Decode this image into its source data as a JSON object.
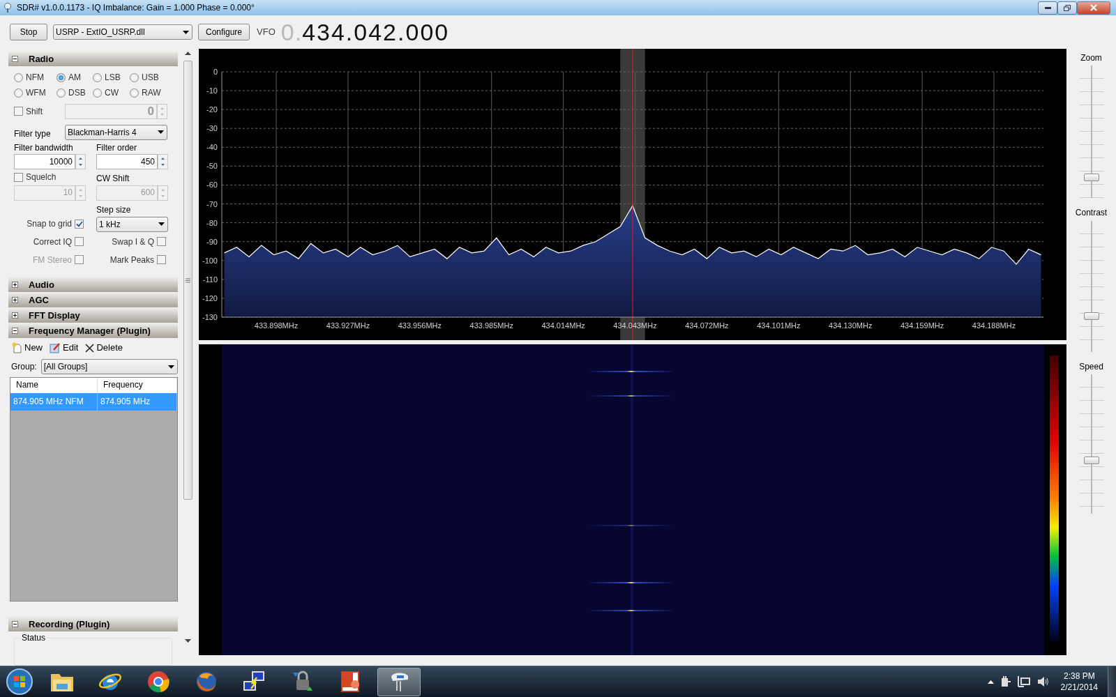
{
  "window": {
    "title": "SDR# v1.0.0.1173 - IQ Imbalance: Gain = 1.000 Phase = 0.000°"
  },
  "toolbar": {
    "stop_button": "Stop",
    "source": "USRP - ExtIO_USRP.dll",
    "configure_button": "Configure",
    "vfo_label": "VFO",
    "vfo_prefix": "0.",
    "vfo_value": "434.042.000"
  },
  "sections": [
    {
      "kind": "radio",
      "title": "Radio",
      "expanded": true,
      "modes": [
        {
          "label": "NFM",
          "selected": false
        },
        {
          "label": "AM",
          "selected": true
        },
        {
          "label": "LSB",
          "selected": false
        },
        {
          "label": "USB",
          "selected": false
        },
        {
          "label": "WFM",
          "selected": false
        },
        {
          "label": "DSB",
          "selected": false
        },
        {
          "label": "CW",
          "selected": false
        },
        {
          "label": "RAW",
          "selected": false
        }
      ],
      "shift": {
        "label": "Shift",
        "checked": false,
        "value": "0",
        "disabled": true
      },
      "filter_type": {
        "label": "Filter type",
        "value": "Blackman-Harris 4"
      },
      "filter_bandwidth": {
        "label": "Filter bandwidth",
        "value": "10000"
      },
      "filter_order": {
        "label": "Filter order",
        "value": "450"
      },
      "squelch": {
        "label": "Squelch",
        "checked": false,
        "value": "10",
        "disabled": true
      },
      "cw_shift": {
        "label": "CW Shift",
        "value": "600",
        "disabled": true
      },
      "snap_to_grid": {
        "label": "Snap to grid",
        "checked": true
      },
      "step_size": {
        "label": "Step size",
        "value": "1 kHz"
      },
      "options": [
        {
          "label": "Correct IQ",
          "checked": false,
          "disabled": false
        },
        {
          "label": "Swap I & Q",
          "checked": false,
          "disabled": false
        },
        {
          "label": "FM Stereo",
          "checked": false,
          "disabled": true
        },
        {
          "label": "Mark Peaks",
          "checked": false,
          "disabled": false
        }
      ]
    },
    {
      "kind": "collapsed",
      "title": "Audio",
      "expanded": false
    },
    {
      "kind": "collapsed",
      "title": "AGC",
      "expanded": false
    },
    {
      "kind": "collapsed",
      "title": "FFT Display",
      "expanded": false
    },
    {
      "kind": "frequency_manager",
      "title": "Frequency Manager (Plugin)",
      "expanded": true,
      "actions": [
        {
          "kind": "new",
          "label": "New"
        },
        {
          "kind": "edit",
          "label": "Edit"
        },
        {
          "kind": "delete",
          "label": "Delete"
        }
      ],
      "group": {
        "label": "Group:",
        "value": "[All Groups]"
      },
      "table": {
        "columns": [
          "Name",
          "Frequency"
        ],
        "rows": [
          {
            "cells": [
              "874.905 MHz NFM",
              "874.905 MHz"
            ],
            "selected": true
          }
        ]
      }
    },
    {
      "kind": "recording",
      "title": "Recording (Plugin)",
      "expanded": true,
      "status_label": "Status"
    }
  ],
  "spectrum": {
    "chart_data": {
      "type": "area",
      "xlim": [
        433.876,
        434.208
      ],
      "ylim": [
        -130,
        0
      ],
      "grid": true,
      "bands": [
        {
          "axis": "x",
          "from": 434.037,
          "to": 434.047,
          "color": "#3a3a3a"
        }
      ],
      "ref_lines": [
        {
          "axis": "x",
          "value": 434.042,
          "color": "#e02020"
        }
      ],
      "yticks": [
        0,
        -10,
        -20,
        -30,
        -40,
        -50,
        -60,
        -70,
        -80,
        -90,
        -100,
        -110,
        -120,
        -130
      ],
      "xticks": [
        {
          "value": 433.898,
          "label": "433.898MHz"
        },
        {
          "value": 433.927,
          "label": "433.927MHz"
        },
        {
          "value": 433.956,
          "label": "433.956MHz"
        },
        {
          "value": 433.985,
          "label": "433.985MHz"
        },
        {
          "value": 434.014,
          "label": "434.014MHz"
        },
        {
          "value": 434.043,
          "label": "434.043MHz"
        },
        {
          "value": 434.072,
          "label": "434.072MHz"
        },
        {
          "value": 434.101,
          "label": "434.101MHz"
        },
        {
          "value": 434.13,
          "label": "434.130MHz"
        },
        {
          "value": 434.159,
          "label": "434.159MHz"
        },
        {
          "value": 434.188,
          "label": "434.188MHz"
        }
      ],
      "x": [
        433.877,
        433.882,
        433.887,
        433.892,
        433.897,
        433.902,
        433.907,
        433.912,
        433.917,
        433.922,
        433.927,
        433.932,
        433.937,
        433.942,
        433.947,
        433.952,
        433.957,
        433.962,
        433.967,
        433.972,
        433.977,
        433.982,
        433.987,
        433.992,
        433.997,
        434.002,
        434.007,
        434.012,
        434.017,
        434.022,
        434.027,
        434.032,
        434.037,
        434.042,
        434.047,
        434.052,
        434.057,
        434.062,
        434.067,
        434.072,
        434.077,
        434.082,
        434.087,
        434.092,
        434.097,
        434.102,
        434.107,
        434.112,
        434.117,
        434.122,
        434.127,
        434.132,
        434.137,
        434.142,
        434.147,
        434.152,
        434.157,
        434.162,
        434.167,
        434.172,
        434.177,
        434.182,
        434.187,
        434.192,
        434.197,
        434.202,
        434.207
      ],
      "series": [
        {
          "color": "#ffffff",
          "values": [
            -96,
            -93,
            -98,
            -92,
            -97,
            -95,
            -99,
            -91,
            -96,
            -94,
            -98,
            -93,
            -97,
            -95,
            -92,
            -98,
            -96,
            -94,
            -99,
            -93,
            -96,
            -95,
            -88,
            -97,
            -94,
            -98,
            -93,
            -96,
            -95,
            -92,
            -90,
            -86,
            -82,
            -71,
            -88,
            -92,
            -95,
            -97,
            -94,
            -99,
            -93,
            -96,
            -95,
            -98,
            -94,
            -97,
            -93,
            -96,
            -99,
            -94,
            -95,
            -92,
            -97,
            -96,
            -94,
            -98,
            -93,
            -95,
            -97,
            -94,
            -96,
            -99,
            -93,
            -95,
            -102,
            -94,
            -97
          ]
        }
      ]
    }
  },
  "sliders": [
    {
      "label": "Zoom",
      "level": 0.14
    },
    {
      "label": "Contrast",
      "level": 0.26
    },
    {
      "label": "Speed",
      "level": 0.38
    }
  ],
  "taskbar": {
    "apps": [
      {
        "kind": "folder",
        "active": false
      },
      {
        "kind": "ie",
        "active": false
      },
      {
        "kind": "chrome",
        "active": false
      },
      {
        "kind": "firefox",
        "active": false
      },
      {
        "kind": "network",
        "active": false
      },
      {
        "kind": "lock",
        "active": false
      },
      {
        "kind": "slides",
        "active": false
      },
      {
        "kind": "mixer",
        "active": true
      }
    ],
    "clock_time": "2:38 PM",
    "clock_date": "2/21/2014"
  }
}
